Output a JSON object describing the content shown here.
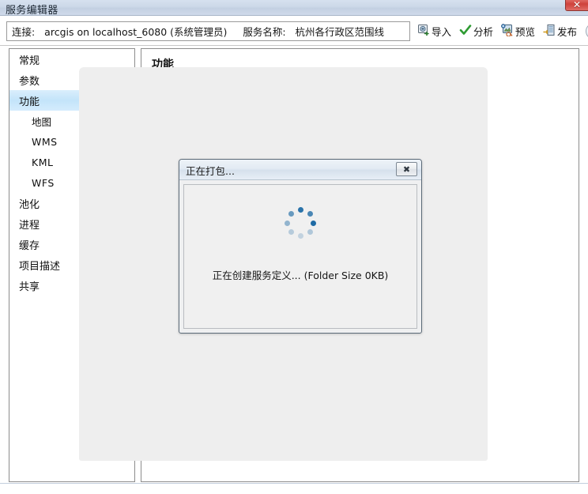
{
  "window": {
    "title": "服务编辑器",
    "close_label": "✕",
    "close_icon": "window-close-icon"
  },
  "toolbar": {
    "connection_label": "连接:",
    "connection_value": "arcgis on localhost_6080 (系统管理员)",
    "service_name_label": "服务名称:",
    "service_name_value": "杭州各行政区范围线",
    "actions": [
      {
        "label": "导入",
        "icon": "import-icon"
      },
      {
        "label": "分析",
        "icon": "analyze-check-icon"
      },
      {
        "label": "预览",
        "icon": "preview-icon"
      },
      {
        "label": "发布",
        "icon": "publish-icon"
      }
    ],
    "collapse_icon": "chevron-up-icon"
  },
  "sidebar": {
    "items": [
      {
        "label": "常规",
        "level": 0,
        "selected": false
      },
      {
        "label": "参数",
        "level": 0,
        "selected": false
      },
      {
        "label": "功能",
        "level": 0,
        "selected": true
      },
      {
        "label": "地图",
        "level": 1,
        "selected": false
      },
      {
        "label": "WMS",
        "level": 1,
        "selected": false
      },
      {
        "label": "KML",
        "level": 1,
        "selected": false
      },
      {
        "label": "WFS",
        "level": 1,
        "selected": false
      },
      {
        "label": "池化",
        "level": 0,
        "selected": false
      },
      {
        "label": "进程",
        "level": 0,
        "selected": false
      },
      {
        "label": "缓存",
        "level": 0,
        "selected": false
      },
      {
        "label": "项目描述",
        "level": 0,
        "selected": false
      },
      {
        "label": "共享",
        "level": 0,
        "selected": false
      }
    ]
  },
  "content": {
    "title": "功能"
  },
  "dialog": {
    "title": "正在打包...",
    "close_label": "✖",
    "close_icon": "dialog-close-icon",
    "spinner_icon": "loading-spinner-icon",
    "status": "正在创建服务定义... (Folder Size 0KB)"
  },
  "colors": {
    "titlebar_start": "#d6e1ef",
    "titlebar_end": "#cfdaea",
    "selection_blue": "#c3e4fa",
    "spinner_blue": "#1f6ba5",
    "close_red": "#cf413b",
    "sheet_grey": "#eeeeee"
  }
}
